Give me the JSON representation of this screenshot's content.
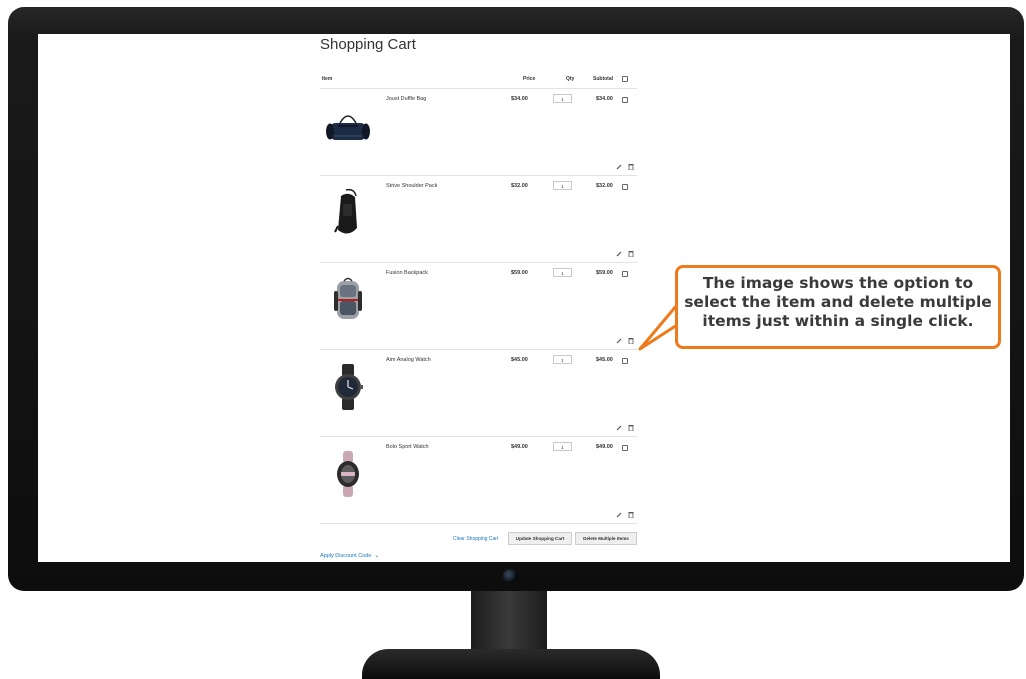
{
  "page": {
    "title": "Shopping Cart",
    "columns": {
      "item": "Item",
      "price": "Price",
      "qty": "Qty",
      "subtotal": "Subtotal"
    },
    "items": [
      {
        "name": "Joust Duffle Bag",
        "price": "$34.00",
        "qty": "1",
        "subtotal": "$34.00",
        "icon": "duffle-bag-icon"
      },
      {
        "name": "Strive Shoulder Pack",
        "price": "$32.00",
        "qty": "1",
        "subtotal": "$32.00",
        "icon": "sling-pack-icon"
      },
      {
        "name": "Fusion Backpack",
        "price": "$59.00",
        "qty": "1",
        "subtotal": "$59.00",
        "icon": "backpack-icon"
      },
      {
        "name": "Aim Analog Watch",
        "price": "$45.00",
        "qty": "1",
        "subtotal": "$45.00",
        "icon": "analog-watch-icon"
      },
      {
        "name": "Bolo Sport Watch",
        "price": "$49.00",
        "qty": "1",
        "subtotal": "$49.00",
        "icon": "sport-watch-icon"
      }
    ],
    "actions": {
      "clear": "Clear Shopping Cart",
      "update": "Update Shopping Cart",
      "delete_multiple": "Delete Multiple Items"
    },
    "discount_link": "Apply Discount Code"
  },
  "callout": {
    "text": "The image shows the option to select the item and delete multiple items just within a single click.",
    "border_color": "#ee7b1b"
  },
  "colors": {
    "link": "#1979c3",
    "monitor": "#111111"
  }
}
